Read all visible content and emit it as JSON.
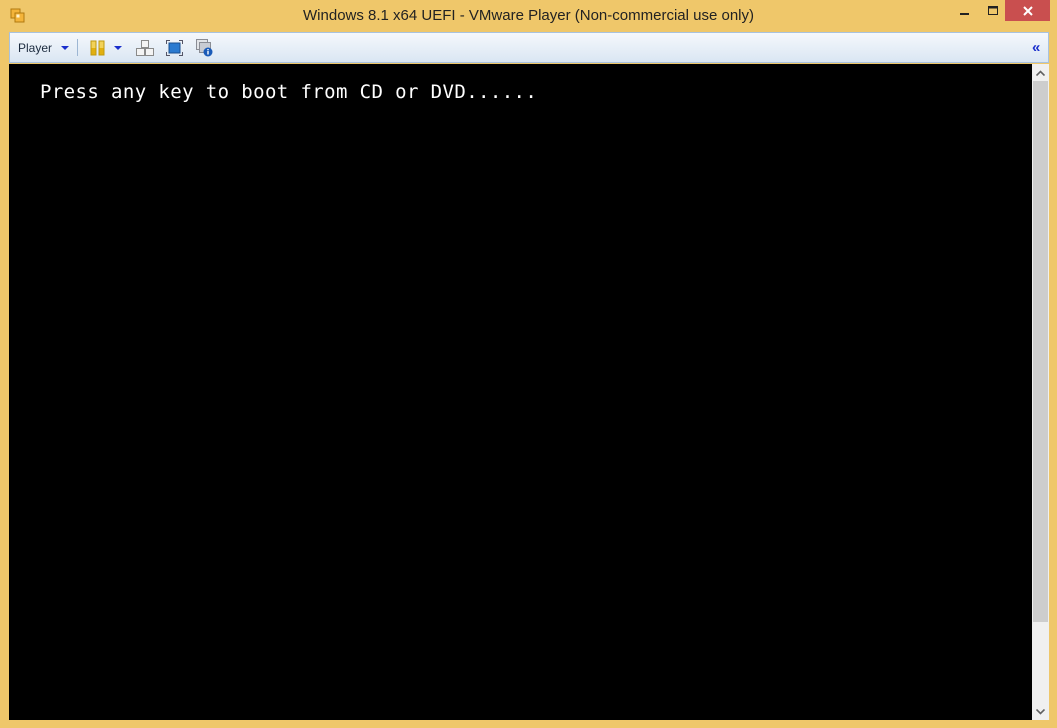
{
  "window": {
    "title": "Windows 8.1 x64 UEFI - VMware Player (Non-commercial use only)",
    "app_icon": "vmware-player-icon",
    "controls": {
      "minimize": "minimize",
      "maximize": "maximize",
      "close": "close"
    }
  },
  "toolbar": {
    "player_menu_label": "Player",
    "items": [
      {
        "name": "pause-icon",
        "label": "Suspend/Pause"
      },
      {
        "name": "send-ctrl-alt-del-icon",
        "label": "Send Ctrl+Alt+Del"
      },
      {
        "name": "full-screen-icon",
        "label": "Enter full screen mode"
      },
      {
        "name": "unity-icon",
        "label": "Unity"
      }
    ],
    "collapse_label": "«"
  },
  "console": {
    "text": "Press any key to boot from CD or DVD......",
    "background": "#000000",
    "foreground": "#ffffff"
  },
  "scrollbar": {
    "thumb_start_fraction": 0.0,
    "thumb_end_fraction": 0.87
  },
  "colors": {
    "frame": "#efc76a",
    "close_button": "#c94f4f",
    "toolbar_arrow": "#1a2ecc"
  }
}
